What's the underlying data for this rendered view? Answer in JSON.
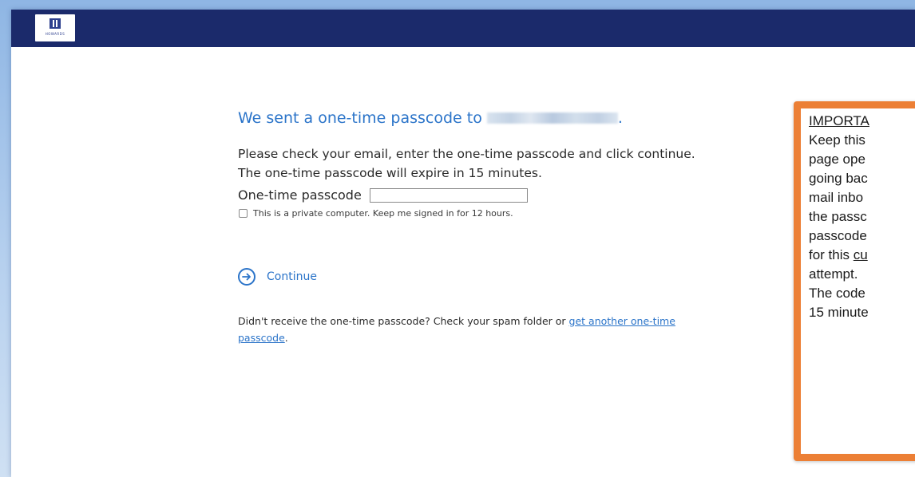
{
  "header": {
    "logo_text": "HOWARDS"
  },
  "main": {
    "heading_prefix": "We sent a one-time passcode to",
    "heading_suffix": ".",
    "instruction_line1": "Please check your email, enter the one-time passcode and click continue.",
    "instruction_line2": "The one-time passcode will expire in 15 minutes.",
    "otp_label": "One-time passcode",
    "otp_value": "",
    "remember_label": "This is a private computer. Keep me signed in for 12 hours.",
    "remember_checked": false,
    "continue_label": "Continue",
    "resend_text": "Didn't receive the one-time passcode? Check your spam folder or ",
    "resend_link_part1": "get another one-time",
    "resend_link_part2": "passcode",
    "resend_suffix": "."
  },
  "callout": {
    "title": "IMPORTA",
    "line1": "Keep this",
    "line2": "page ope",
    "line3": "going bac",
    "line4": "mail inbo",
    "line5": "the passc",
    "line6": "passcode",
    "line7_prefix": "for this ",
    "line7_underlined": "cu",
    "line8": "attempt.",
    "line9": "The code",
    "line10": "15 minute"
  },
  "colors": {
    "header_bg": "#1b2a6b",
    "link_blue": "#2b74c9",
    "callout_border": "#ec7f35"
  }
}
